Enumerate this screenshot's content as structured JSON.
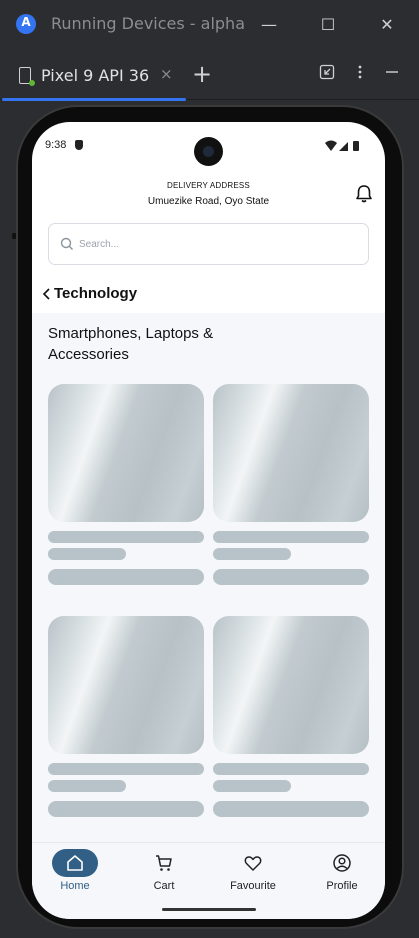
{
  "window": {
    "title": "Running Devices - alpha",
    "tab_label": "Pixel 9 API 36",
    "tab_close": "×",
    "tab_add": "+",
    "minimize": "—",
    "maximize": "☐",
    "close": "✕"
  },
  "status": {
    "time": "9:38"
  },
  "header": {
    "address_label": "DELIVERY ADDRESS",
    "address_value": "Umuezike Road, Oyo State"
  },
  "search": {
    "placeholder": "Search..."
  },
  "section": {
    "title": "Technology"
  },
  "category": {
    "title": "Smartphones, Laptops & Accessories"
  },
  "nav": {
    "items": [
      {
        "label": "Home",
        "active": true
      },
      {
        "label": "Cart",
        "active": false
      },
      {
        "label": "Favourite",
        "active": false
      },
      {
        "label": "Profile",
        "active": false
      }
    ]
  },
  "colors": {
    "accent": "#315f86",
    "ide_accent": "#3574f0",
    "skeleton": "#b7c3c9"
  }
}
